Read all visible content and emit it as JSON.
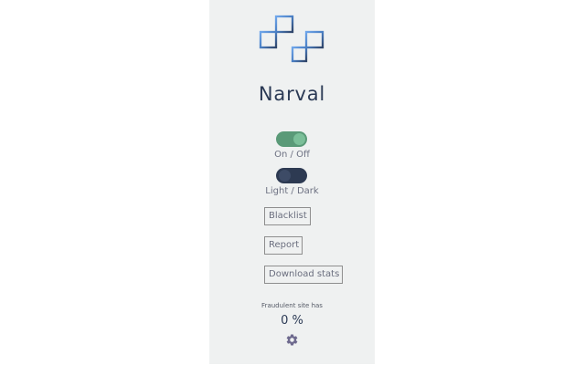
{
  "app": {
    "name": "Narval",
    "logo_icon": "narval-logo-icon"
  },
  "toggles": {
    "power": {
      "label": "On / Off",
      "state": "on",
      "color": "#5a9a78"
    },
    "theme": {
      "label": "Light / Dark",
      "state": "light",
      "color": "#2d3a52"
    }
  },
  "buttons": {
    "blacklist": "Blacklist",
    "report": "Report",
    "download_stats": "Download stats"
  },
  "stats": {
    "fraud_label": "Fraudulent site has",
    "fraud_value": "0 %"
  },
  "settings": {
    "icon": "gear-icon"
  },
  "colors": {
    "panel_bg": "#eff1f1",
    "brand_dark": "#2b3a55",
    "logo_blue": "#5b8fd6"
  }
}
